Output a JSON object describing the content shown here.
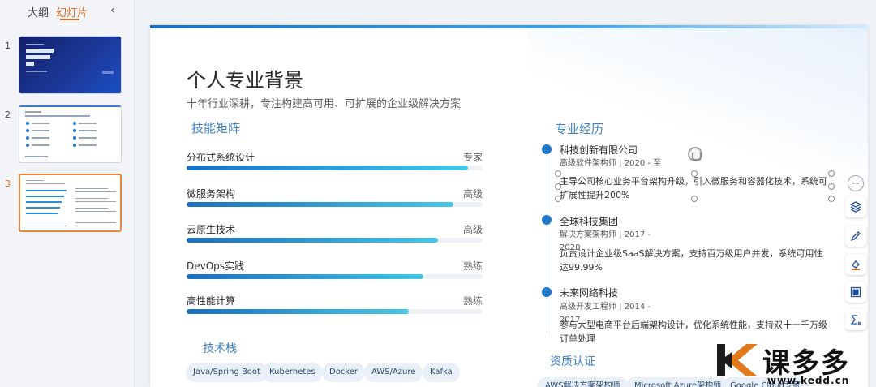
{
  "left_panel": {
    "tabs": {
      "outline": "大纲",
      "slides": "幻灯片"
    },
    "collapse_icon": "chevron-left-icon",
    "thumbnails": [
      {
        "number": "1",
        "active": false
      },
      {
        "number": "2",
        "active": false
      },
      {
        "number": "3",
        "active": true
      }
    ]
  },
  "slide": {
    "title": "个人专业背景",
    "subtitle": "十年行业深耕，专注构建高可用、可扩展的企业级解决方案",
    "skills_heading": "技能矩阵",
    "skills": [
      {
        "name": "分布式系统设计",
        "level": "专家",
        "fill": 0.95
      },
      {
        "name": "微服务架构",
        "level": "高级",
        "fill": 0.9
      },
      {
        "name": "云原生技术",
        "level": "高级",
        "fill": 0.85
      },
      {
        "name": "DevOps实践",
        "level": "熟练",
        "fill": 0.8
      },
      {
        "name": "高性能计算",
        "level": "熟练",
        "fill": 0.75
      }
    ],
    "tech_heading": "技术栈",
    "tech_stack": [
      "Java/Spring Boot",
      "Kubernetes",
      "Docker",
      "AWS/Azure",
      "Kafka"
    ],
    "experience_heading": "专业经历",
    "experience": [
      {
        "company": "科技创新有限公司",
        "role": "高级软件架构师 | 2020 - 至",
        "desc": "主导公司核心业务平台架构升级，引入微服务和容器化技术，系统可扩展性提升200%"
      },
      {
        "company": "全球科技集团",
        "role": "解决方案架构师 | 2017 - 2020",
        "desc": "负责设计企业级SaaS解决方案，支持百万级用户并发，系统可用性达99.99%"
      },
      {
        "company": "未来网络科技",
        "role": "高级开发工程师 | 2014 - 2017",
        "desc": "参与大型电商平台后端架构设计，优化系统性能，支持双十一千万级订单处理"
      }
    ],
    "cert_heading": "资质认证",
    "certs": [
      "AWS解决方案架构师",
      "Microsoft Azure架构师",
      "Google Cloud专家"
    ]
  },
  "toolbar": {
    "icons": [
      "minus-icon",
      "layers-icon",
      "pen-icon",
      "paint-bucket-icon",
      "frame-icon",
      "function-icon"
    ]
  },
  "watermark": {
    "brand": "课多多",
    "url": "www.kedd.cn"
  }
}
